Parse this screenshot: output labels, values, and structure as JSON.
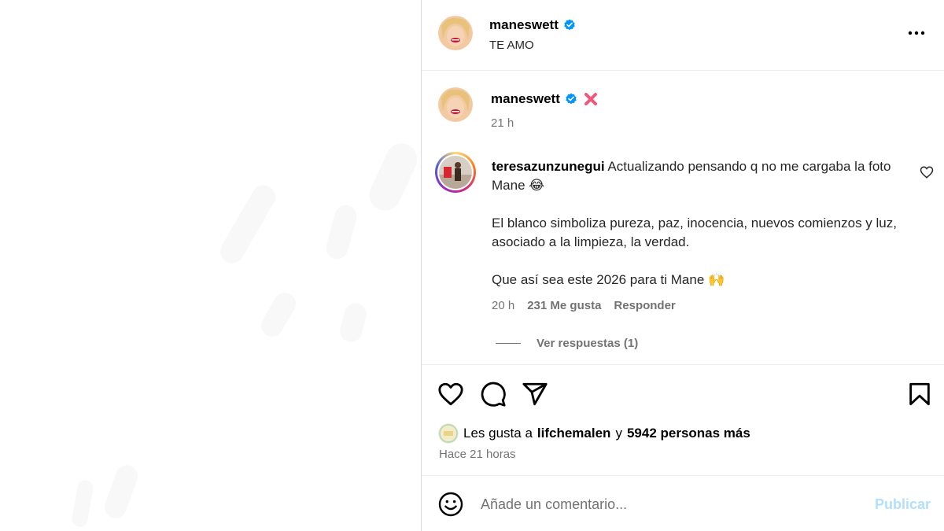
{
  "post": {
    "username": "maneswett",
    "subtitle": "TE AMO",
    "more_icon": "more-horizontal-icon"
  },
  "caption": {
    "username": "maneswett",
    "emoji": "cross-mark-icon",
    "time": "21 h"
  },
  "comment": {
    "username": "teresazunzunegui",
    "line1": "Actualizando pensando q no me cargaba la foto Mane 😂",
    "line2": "El blanco simboliza pureza, paz, inocencia, nuevos comienzos y luz, asociado a la limpieza, la verdad.",
    "line3": "Que así sea este 2026 para ti Mane 🙌",
    "time": "20 h",
    "likes": "231 Me gusta",
    "reply": "Responder",
    "view_replies": "Ver respuestas (1)"
  },
  "actions": {
    "liked_prefix": "Les gusta a",
    "liked_user": "lifchemalen",
    "liked_joiner": "y",
    "liked_others": "5942 personas más",
    "posted_ago": "Hace 21 horas"
  },
  "composer": {
    "placeholder": "Añade un comentario...",
    "publish_label": "Publicar"
  },
  "colors": {
    "verified": "#0095f6",
    "publish_disabled": "#b2dffc",
    "muted": "#737373"
  }
}
